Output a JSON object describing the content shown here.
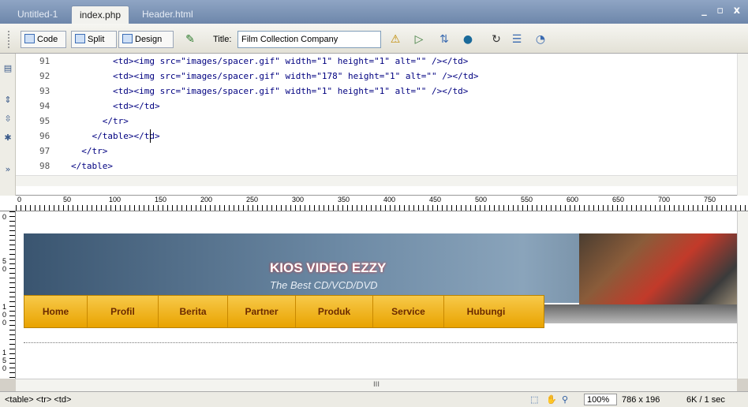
{
  "tabs": [
    {
      "label": "Untitled-1"
    },
    {
      "label": "index.php"
    },
    {
      "label": "Header.html"
    }
  ],
  "window_controls": "_ ▫ x",
  "toolbar": {
    "code_label": "Code",
    "split_label": "Split",
    "design_label": "Design",
    "title_label": "Title:",
    "title_value": "Film Collection Company"
  },
  "code": {
    "lines": [
      {
        "num": "91",
        "text": "        <td><img src=\"images/spacer.gif\" width=\"1\" height=\"1\" alt=\"\" /></td>"
      },
      {
        "num": "92",
        "text": "        <td><img src=\"images/spacer.gif\" width=\"178\" height=\"1\" alt=\"\" /></td>"
      },
      {
        "num": "93",
        "text": "        <td><img src=\"images/spacer.gif\" width=\"1\" height=\"1\" alt=\"\" /></td>"
      },
      {
        "num": "94",
        "text": "        <td></td>"
      },
      {
        "num": "95",
        "text": "      </tr>"
      },
      {
        "num": "96",
        "text": "    </table></td>"
      },
      {
        "num": "97",
        "text": "  </tr>"
      },
      {
        "num": "98",
        "text": "</table>"
      }
    ]
  },
  "ruler": {
    "ticks": [
      "0",
      "50",
      "100",
      "150",
      "200",
      "250",
      "300",
      "350",
      "400",
      "450",
      "500",
      "550",
      "600",
      "650",
      "700",
      "750"
    ]
  },
  "vruler": {
    "ticks": [
      "0",
      "5 0",
      "1 0 0",
      "1 5 0"
    ]
  },
  "site": {
    "title": "KIOS VIDEO EZZY",
    "subtitle": "The Best CD/VCD/DVD",
    "nav": [
      "Home",
      "Profil",
      "Berita",
      "Partner",
      "Produk",
      "Service",
      "Hubungi"
    ]
  },
  "scroll_label": "III",
  "status": {
    "tag_selector": "<table> <tr> <td>",
    "zoom": "100%",
    "dims": "786 x 196",
    "size": "6K / 1 sec"
  }
}
